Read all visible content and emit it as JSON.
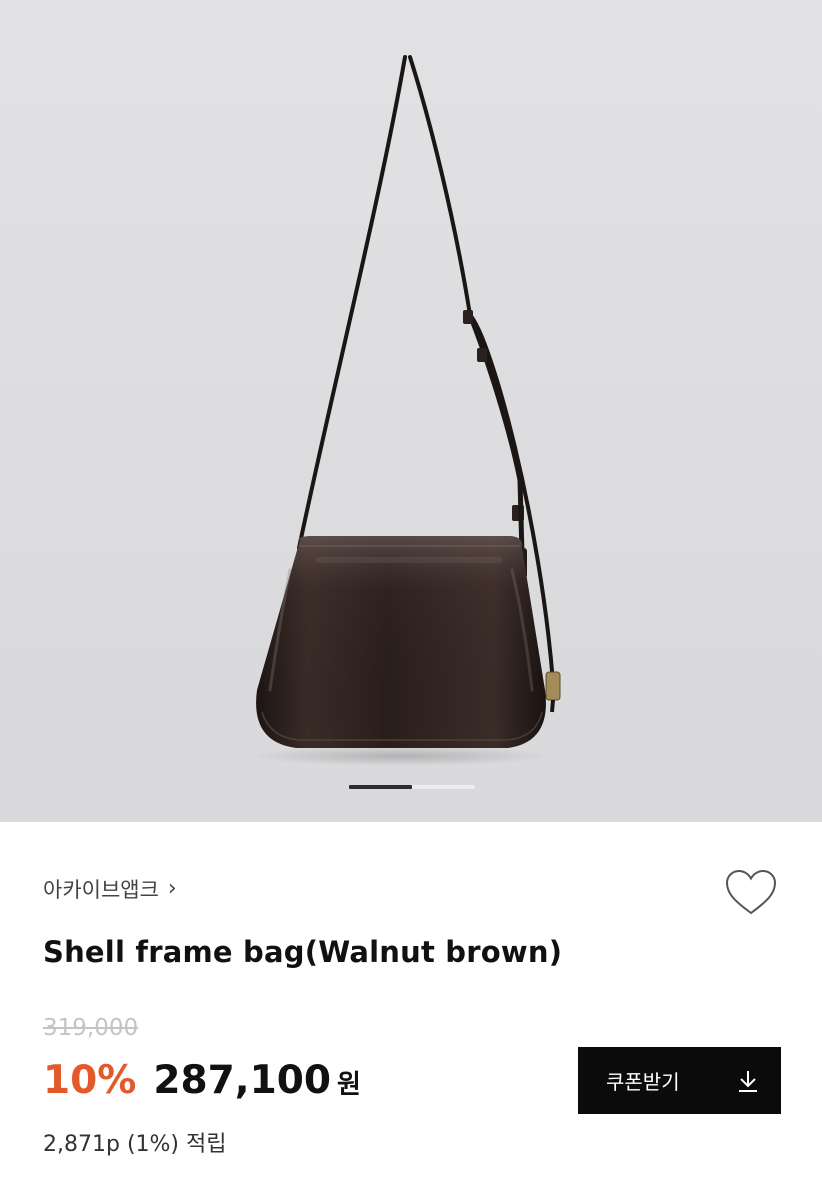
{
  "product": {
    "brand": "아카이브앱크",
    "title": "Shell frame bag(Walnut brown)",
    "original_price": "319,000",
    "discount": "10%",
    "price": "287,100",
    "currency": "원",
    "points": "2,871p (1%) 적립"
  },
  "actions": {
    "coupon_label": "쿠폰받기"
  },
  "carousel": {
    "current_slide_fraction": 0.5
  },
  "colors": {
    "discount": "#e35a2a",
    "button_bg": "#0b0b0b"
  },
  "icons": {
    "brand_link": "chevron-right-icon",
    "wishlist": "heart-icon",
    "coupon": "download-icon"
  }
}
